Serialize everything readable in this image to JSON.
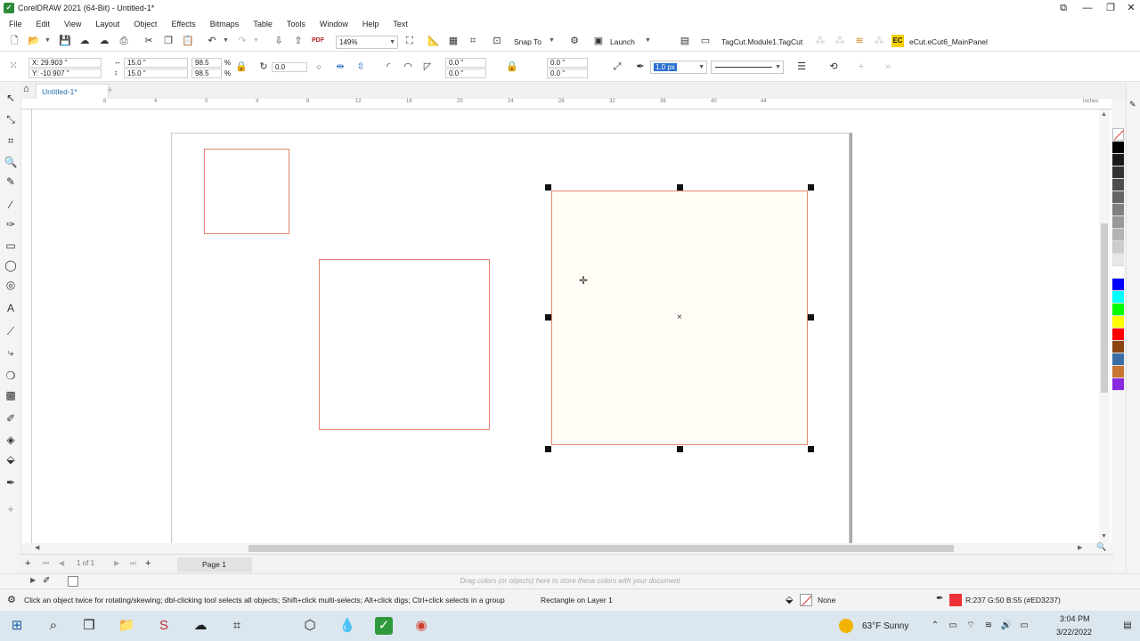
{
  "window": {
    "title": "CorelDRAW 2021 (64-Bit) - Untitled-1*"
  },
  "menu": [
    "File",
    "Edit",
    "View",
    "Layout",
    "Object",
    "Effects",
    "Bitmaps",
    "Table",
    "Tools",
    "Window",
    "Help",
    "Text"
  ],
  "standard_toolbar": {
    "zoom": "149%",
    "snap_to": "Snap To",
    "launch": "Launch",
    "tagcut": "TagCut.Module1.TagCut",
    "ec_badge": "EC",
    "ecut_panel": "eCut.eCut6_MainPanel",
    "pdf_label": "PDF"
  },
  "property_bar": {
    "x": "X: 29.903 \"",
    "y": "Y: -10.907 \"",
    "width": "15.0 \"",
    "height": "15.0 \"",
    "scale_w": "98.5",
    "scale_h": "98.5",
    "pct": "%",
    "rotation": "0.0",
    "corner_1": "0.0 \"",
    "corner_2": "0.0 \"",
    "corner_3": "0.0 \"",
    "corner_4": "0.0 \"",
    "outline_width": "1.0 px"
  },
  "document_tab": {
    "name": "Untitled-1*"
  },
  "ruler": {
    "units": "inches",
    "labels": [
      "8",
      "4",
      "0",
      "4",
      "8",
      "12",
      "16",
      "20",
      "24",
      "28",
      "32",
      "36",
      "40",
      "44"
    ]
  },
  "page_nav": {
    "counter": "1 of 1",
    "page_tab": "Page 1"
  },
  "dock_hint": "Drag colors (or objects) here to store these colors with your document",
  "status": {
    "hint": "Click an object twice for rotating/skewing; dbl-clicking tool selects all objects; Shift+click multi-selects; Alt+click digs; Ctrl+click selects in a group",
    "selection": "Rectangle on Layer 1",
    "fill": "None",
    "outline_color": "R:237 G:50 B:55 (#ED3237)",
    "outline_hex": "#ED3237"
  },
  "taskbar": {
    "weather": "63°F  Sunny",
    "time": "3:04 PM",
    "date": "3/22/2022"
  },
  "palette_colors": [
    "#000000",
    "#1a1a1a",
    "#333333",
    "#4d4d4d",
    "#666666",
    "#808080",
    "#999999",
    "#b3b3b3",
    "#cccccc",
    "#e6e6e6",
    "#ffffff",
    "#0000ff",
    "#00ffff",
    "#00ff00",
    "#ffff00",
    "#ff0000",
    "#8b4513",
    "#3a6ea5",
    "#c87533",
    "#8a2be2"
  ]
}
